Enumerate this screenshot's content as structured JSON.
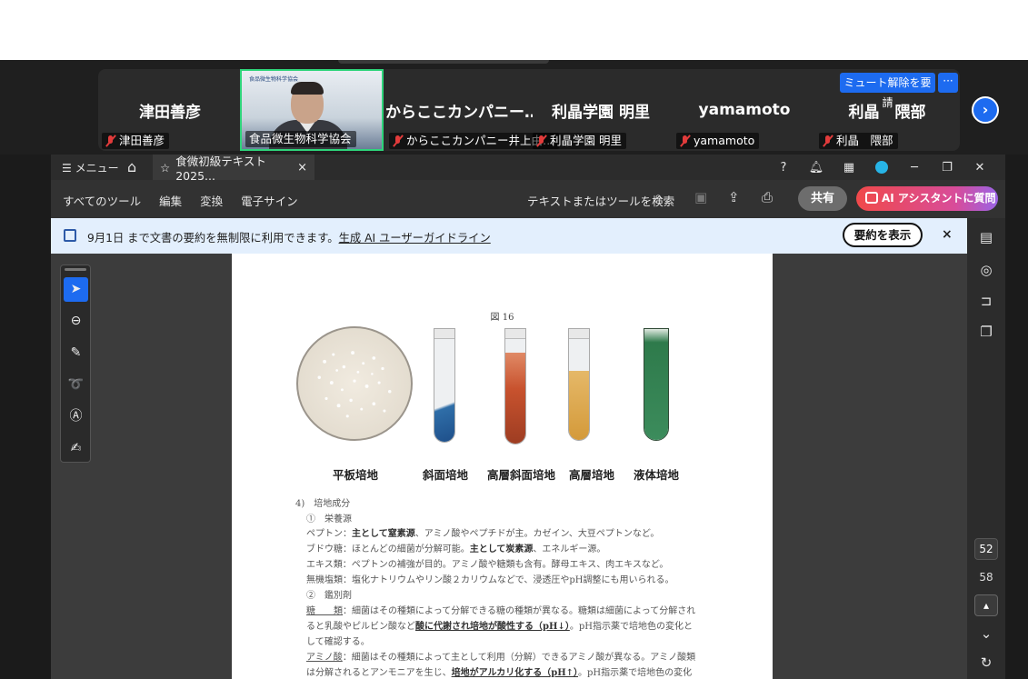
{
  "meeting": {
    "unmute_request": "ミュート解除を要請",
    "more": "···",
    "next": "›",
    "participants": [
      {
        "name": "津田善彦",
        "label": "津田善彦"
      },
      {
        "name": "",
        "label": "食品微生物科学協会",
        "logo": "食品微生物科学協会"
      },
      {
        "name": "からここカンパニー…",
        "label": "からここカンパニー井上由…"
      },
      {
        "name": "利晶学園 明里",
        "label": "利晶学園 明里"
      },
      {
        "name": "yamamoto",
        "label": "yamamoto"
      },
      {
        "name": "利晶　隈部",
        "label": "利晶　隈部"
      }
    ]
  },
  "titlebar": {
    "menu": "☰ メニュー",
    "tab_title": "食微初級テキスト2025...",
    "tab_close": "×"
  },
  "toolbar": {
    "all_tools": "すべてのツール",
    "edit": "編集",
    "convert": "変換",
    "esign": "電子サイン",
    "search": "テキストまたはツールを検索",
    "share": "共有",
    "ai": "AI アシスタントに質問"
  },
  "banner": {
    "text": "9月1日 まで文書の要約を無制限に利用できます。",
    "link": "生成 AI ユーザーガイドライン",
    "summary": "要約を表示",
    "close": "×"
  },
  "sidebar": {
    "current_page": "52",
    "total_pages": "58"
  },
  "document": {
    "figure_title": "図 16",
    "media": [
      "平板培地",
      "斜面培地",
      "高層斜面培地",
      "高層培地",
      "液体培地"
    ],
    "section": "4)　培地成分",
    "sub1": "①　栄養源",
    "l1a": "ペプトン：",
    "l1b": "主として窒素源",
    "l1c": "、アミノ酸やペプチドが主。カゼイン、大豆ペプトンなど。",
    "l2a": "ブドウ糖：ほとんどの細菌が分解可能。",
    "l2b": "主として炭素源",
    "l2c": "、エネルギー源。",
    "l3": "エキス類：ペプトンの補強が目的。アミノ酸や糖類も含有。酵母エキス、肉エキスなど。",
    "l4": "無機塩類：塩化ナトリウムやリン酸２カリウムなどで、浸透圧やpH調整にも用いられる。",
    "sub2": "②　鑑別剤",
    "l5a": "糖　　類",
    "l5b": "：細菌はその種類によって分解できる糖の種類が異なる。糖類は細菌によって分解され",
    "l6a": "ると乳酸やピルビン酸など",
    "l6b": "酸に代謝され培地が酸性する（pH↓）",
    "l6c": "。pH指示薬で培地色の変化と",
    "l7": "して確認する。",
    "l8a": "アミノ酸",
    "l8b": "：細菌はその種類によって主として利用（分解）できるアミノ酸が異なる。アミノ酸類",
    "l9a": "は分解されるとアンモニアを生じ、",
    "l9b": "培地がアルカリ化する（pH↑）",
    "l9c": "。pH指示薬で培地色の変化"
  },
  "colors": {
    "accent": "#1d6bf0",
    "banner_bg": "#e3effd",
    "active_speaker": "#2ed47a"
  }
}
